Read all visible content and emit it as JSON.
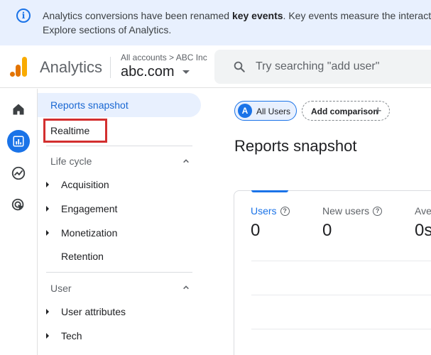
{
  "banner": {
    "text_pre": "Analytics conversions have been renamed ",
    "text_bold": "key events",
    "text_post": ". Key events measure the interactions",
    "line2": "Explore sections of Analytics."
  },
  "header": {
    "app_name": "Analytics",
    "account_breadcrumb": "All accounts > ABC Inc",
    "property_name": "abc.com",
    "search_placeholder": "Try searching \"add user\""
  },
  "rail": {
    "icons": [
      "home-icon",
      "reports-icon",
      "explore-icon",
      "advertising-icon"
    ],
    "active_index": 1
  },
  "nav": {
    "reports_snapshot": "Reports snapshot",
    "realtime": "Realtime",
    "lifecycle": {
      "title": "Life cycle",
      "items": [
        "Acquisition",
        "Engagement",
        "Monetization",
        "Retention"
      ]
    },
    "user": {
      "title": "User",
      "items": [
        "User attributes",
        "Tech"
      ]
    }
  },
  "main": {
    "chip_all_users": "All Users",
    "chip_avatar": "A",
    "add_comparison": "Add comparison",
    "title": "Reports snapshot",
    "metrics": [
      {
        "label": "Users",
        "value": "0"
      },
      {
        "label": "New users",
        "value": "0"
      },
      {
        "label": "Ave",
        "value": "0s"
      }
    ]
  },
  "colors": {
    "accent": "#1a73e8",
    "highlight_box": "#d32f2f",
    "banner_bg": "#e8f0fe"
  }
}
